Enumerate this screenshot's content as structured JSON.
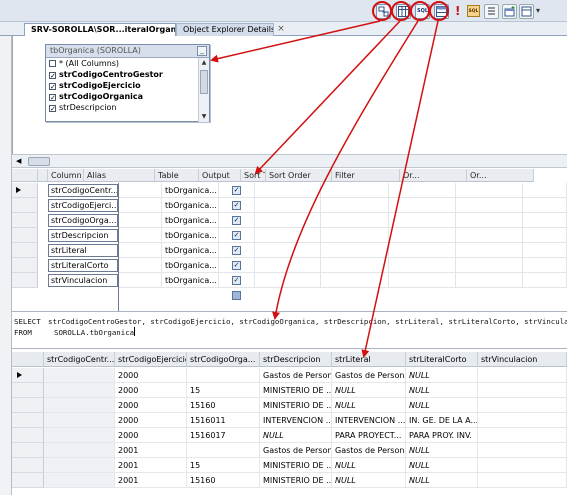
{
  "tabs": {
    "query_tab": "SRV-SOROLLA\\SOR...iteralOrganica*",
    "oed_tab": "Object Explorer Details",
    "close_glyph": "×"
  },
  "toolbar": {
    "diagram_btn": "diagram-pane-icon",
    "criteria_btn": "criteria-pane-icon",
    "sql_btn_label": "SQL",
    "results_btn": "results-pane-icon",
    "exec_glyph": "!",
    "verify_label": "SQL",
    "overflow_glyph": "▾"
  },
  "table_window": {
    "title": "tbOrganica (SOROLLA)",
    "min_glyph": "_",
    "columns": [
      {
        "label": "* (All Columns)",
        "checked": false,
        "bold": false
      },
      {
        "label": "strCodigoCentroGestor",
        "checked": true,
        "bold": true
      },
      {
        "label": "strCodigoEjercicio",
        "checked": true,
        "bold": true
      },
      {
        "label": "strCodigoOrganica",
        "checked": true,
        "bold": true
      },
      {
        "label": "strDescripcion",
        "checked": true,
        "bold": false
      }
    ]
  },
  "criteria": {
    "headers": [
      "Column",
      "Alias",
      "Table",
      "Output",
      "Sort Type",
      "Sort Order",
      "Filter",
      "Or...",
      "Or..."
    ],
    "rows": [
      {
        "column": "strCodigoCentr...",
        "alias": "",
        "table": "tbOrganica...",
        "output": true
      },
      {
        "column": "strCodigoEjerci...",
        "alias": "",
        "table": "tbOrganica...",
        "output": true
      },
      {
        "column": "strCodigoOrga...",
        "alias": "",
        "table": "tbOrganica...",
        "output": true
      },
      {
        "column": "strDescripcion",
        "alias": "",
        "table": "tbOrganica...",
        "output": true
      },
      {
        "column": "strLiteral",
        "alias": "",
        "table": "tbOrganica...",
        "output": true
      },
      {
        "column": "strLiteralCorto",
        "alias": "",
        "table": "tbOrganica...",
        "output": true
      },
      {
        "column": "strVinculacion",
        "alias": "",
        "table": "tbOrganica...",
        "output": true
      }
    ]
  },
  "sql": {
    "line1_kw": "SELECT",
    "line1": "strCodigoCentroGestor, strCodigoEjercicio, strCodigoOrganica, strDescripcion, strLiteral, strLiteralCorto, strVinculacion",
    "line2_kw": "FROM",
    "line2": "SOROLLA.tbOrganica"
  },
  "results": {
    "headers": [
      "strCodigoCentr...",
      "strCodigoEjercicio",
      "strCodigoOrga...",
      "strDescripcion",
      "strLiteral",
      "strLiteralCorto",
      "strVinculacion"
    ],
    "rows": [
      [
        "",
        "2000",
        "",
        "Gastos de Personal",
        "Gastos de Personal",
        "NULL",
        ""
      ],
      [
        "",
        "2000",
        "15",
        "MINISTERIO DE ...",
        "NULL",
        "NULL",
        ""
      ],
      [
        "",
        "2000",
        "15160",
        "MINISTERIO DE ...",
        "NULL",
        "NULL",
        ""
      ],
      [
        "",
        "2000",
        "1516011",
        "INTERVENCION ...",
        "INTERVENCION ...",
        "IN. GE. DE LA A...",
        ""
      ],
      [
        "",
        "2000",
        "1516017",
        "NULL",
        "PARA PROYECT...",
        "PARA PROY. INV.",
        ""
      ],
      [
        "",
        "2001",
        "",
        "Gastos de Personal",
        "Gastos de Personal",
        "NULL",
        ""
      ],
      [
        "",
        "2001",
        "15",
        "MINISTERIO DE ...",
        "NULL",
        "NULL",
        ""
      ],
      [
        "",
        "2001",
        "15160",
        "MINISTERIO DE ...",
        "NULL",
        "NULL",
        ""
      ]
    ]
  },
  "colors": {
    "annotation": "#d21010",
    "toolbar_bg": "#dfe6f0"
  }
}
